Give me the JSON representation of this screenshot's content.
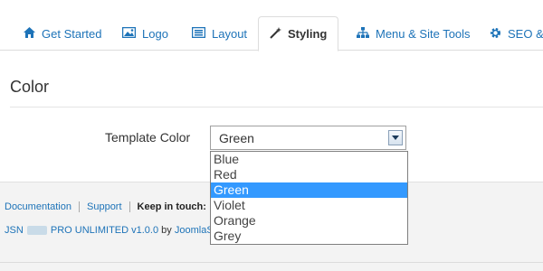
{
  "tabs": [
    {
      "label": "Get Started",
      "icon": "home-icon"
    },
    {
      "label": "Logo",
      "icon": "image-icon"
    },
    {
      "label": "Layout",
      "icon": "layout-icon"
    },
    {
      "label": "Styling",
      "icon": "magic-wand-icon",
      "active": true
    },
    {
      "label": "Menu & Site Tools",
      "icon": "sitemap-icon"
    },
    {
      "label": "SEO &",
      "icon": "gear-icon"
    }
  ],
  "section": {
    "title": "Color"
  },
  "template_color": {
    "label": "Template Color",
    "value": "Green",
    "options": [
      "Blue",
      "Red",
      "Green",
      "Violet",
      "Orange",
      "Grey"
    ],
    "selected": "Green"
  },
  "footer": {
    "documentation": "Documentation",
    "support": "Support",
    "keep_in_touch": "Keep in touch:",
    "product_prefix": "JSN",
    "product_suffix": "PRO UNLIMITED v1.0.0",
    "by": "by",
    "vendor": "JoomlaShin"
  },
  "colors": {
    "link": "#1d73b8",
    "selected_option": "#3399ff"
  }
}
